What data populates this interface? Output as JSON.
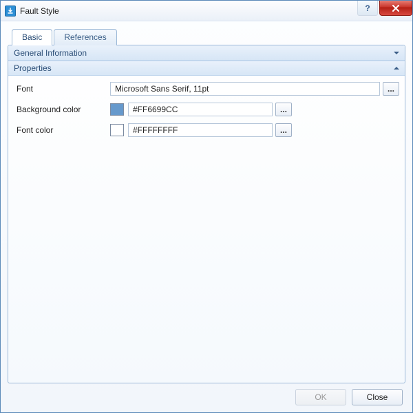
{
  "window": {
    "title": "Fault Style"
  },
  "tabs": {
    "basic": "Basic",
    "references": "References",
    "active": "basic"
  },
  "groups": {
    "general": {
      "title": "General Information",
      "expanded": false
    },
    "properties": {
      "title": "Properties",
      "expanded": true
    }
  },
  "props": {
    "font_label": "Font",
    "font_value": "Microsoft Sans Serif, 11pt",
    "bg_label": "Background color",
    "bg_value": "#FF6699CC",
    "bg_swatch": "#6699CC",
    "fc_label": "Font color",
    "fc_value": "#FFFFFFFF",
    "fc_swatch": "#FFFFFF",
    "ellipsis": "..."
  },
  "buttons": {
    "ok": "OK",
    "close": "Close",
    "ok_enabled": false
  }
}
